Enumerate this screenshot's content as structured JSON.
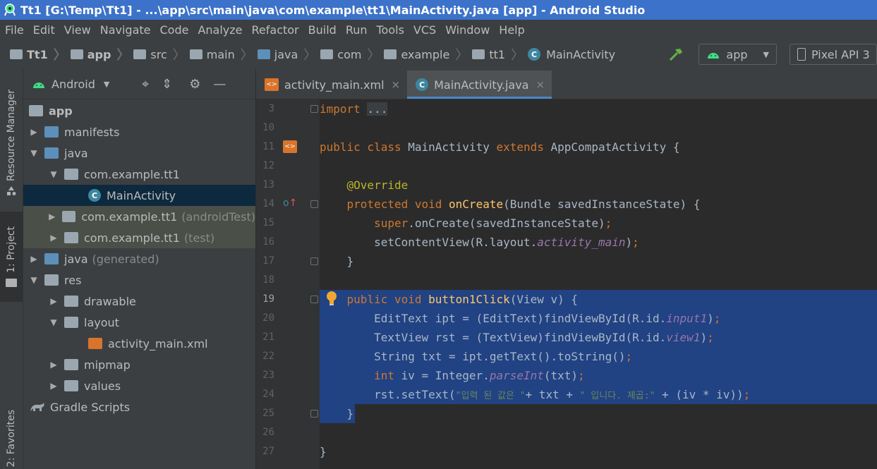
{
  "window": {
    "title": "Tt1 [G:\\Temp\\Tt1] - ...\\app\\src\\main\\java\\com\\example\\tt1\\MainActivity.java [app] - Android Studio"
  },
  "menu": [
    "File",
    "Edit",
    "View",
    "Navigate",
    "Code",
    "Analyze",
    "Refactor",
    "Build",
    "Run",
    "Tools",
    "VCS",
    "Window",
    "Help"
  ],
  "breadcrumb": [
    "Tt1",
    "app",
    "src",
    "main",
    "java",
    "com",
    "example",
    "tt1",
    "MainActivity"
  ],
  "toolbar": {
    "run_config": "app",
    "device": "Pixel API 3"
  },
  "side_tabs": {
    "resource_manager": "Resource Manager",
    "project": "1: Project",
    "favorites": "2: Favorites"
  },
  "project_panel": {
    "view": "Android",
    "tree": [
      {
        "label": "app",
        "suffix": ""
      },
      {
        "label": "manifests",
        "suffix": ""
      },
      {
        "label": "java",
        "suffix": ""
      },
      {
        "label": "com.example.tt1",
        "suffix": ""
      },
      {
        "label": "MainActivity",
        "suffix": ""
      },
      {
        "label": "com.example.tt1",
        "suffix": "(androidTest)"
      },
      {
        "label": "com.example.tt1",
        "suffix": "(test)"
      },
      {
        "label": "java",
        "suffix": "(generated)"
      },
      {
        "label": "res",
        "suffix": ""
      },
      {
        "label": "drawable",
        "suffix": ""
      },
      {
        "label": "layout",
        "suffix": ""
      },
      {
        "label": "activity_main.xml",
        "suffix": ""
      },
      {
        "label": "mipmap",
        "suffix": ""
      },
      {
        "label": "values",
        "suffix": ""
      },
      {
        "label": "Gradle Scripts",
        "suffix": ""
      }
    ]
  },
  "editor": {
    "tabs": [
      {
        "label": "activity_main.xml",
        "close": "×"
      },
      {
        "label": "MainActivity.java",
        "close": "×"
      }
    ],
    "line_numbers": [
      "3",
      "10",
      "11",
      "12",
      "13",
      "14",
      "15",
      "16",
      "17",
      "18",
      "19",
      "20",
      "21",
      "22",
      "23",
      "24",
      "25",
      "26",
      "27"
    ],
    "code": {
      "l3": "import",
      "l3_fold": "...",
      "l11_a": "public class ",
      "l11_b": "MainActivity ",
      "l11_c": "extends ",
      "l11_d": "AppCompatActivity {",
      "l13": "@Override",
      "l14_a": "protected void ",
      "l14_b": "onCreate",
      "l14_c": "(Bundle savedInstanceState) {",
      "l15_a": "super",
      "l15_b": ".onCreate(savedInstanceState)",
      "l15_c": ";",
      "l16_a": "setContentView(R.layout.",
      "l16_b": "activity_main",
      "l16_c": ")",
      "l16_d": ";",
      "l17": "}",
      "l19_a": "public void ",
      "l19_b": "button1Click",
      "l19_c": "(View v) {",
      "l20_a": "EditText ipt = (EditText)findViewById(R.id.",
      "l20_b": "input1",
      "l20_c": ")",
      "l20_d": ";",
      "l21_a": "TextView rst = (TextView)findViewById(R.id.",
      "l21_b": "view1",
      "l21_c": ")",
      "l21_d": ";",
      "l22_a": "String txt = ipt.getText().toString()",
      "l22_b": ";",
      "l23_a": "int ",
      "l23_b": "iv = Integer.",
      "l23_c": "parseInt",
      "l23_d": "(txt)",
      "l23_e": ";",
      "l24_a": "rst.setText(",
      "l24_b": "\"입력 된 값은 \"",
      "l24_c": "+ txt + ",
      "l24_d": "\" 입니다. 제곱:\"",
      "l24_e": " + (iv * iv))",
      "l24_f": ";",
      "l25": "}",
      "l27": "}"
    }
  },
  "colors": {
    "title_bg": "#3c72c9",
    "selection": "#214283",
    "keyword": "#cc7832",
    "function": "#ffc66d",
    "annotation": "#bbb529",
    "italic_field": "#9876aa",
    "string": "#6a8759"
  }
}
